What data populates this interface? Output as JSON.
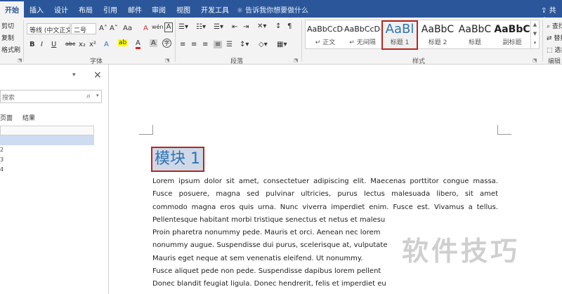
{
  "ribbon_tabs": {
    "home": "开始",
    "insert": "插入",
    "design": "设计",
    "layout": "布局",
    "references": "引用",
    "mailings": "邮件",
    "review": "审阅",
    "view": "视图",
    "developer": "开发工具",
    "tell_me": "告诉我你想要做什么",
    "share": "共享"
  },
  "clipboard": {
    "cut": "剪切",
    "copy": "复制",
    "format_painter": "格式刷"
  },
  "font": {
    "font_name": "等线 (中文正文)",
    "font_size": "二号",
    "group_label": "字体",
    "bold": "B",
    "italic": "I",
    "underline": "U",
    "strike": "abc",
    "subscript": "x₂",
    "superscript": "x²",
    "grow": "A˄",
    "shrink": "A˅",
    "change_case": "Aa",
    "clear": "A",
    "phonetic": "wén",
    "border_char": "A",
    "text_effect": "A",
    "highlight": "ab",
    "font_color": "A",
    "shading": "A",
    "enclosed": "字"
  },
  "paragraph": {
    "group_label": "段落"
  },
  "styles": {
    "group_label": "样式",
    "items": [
      {
        "preview": "AaBbCcDc",
        "name": "↵ 正文"
      },
      {
        "preview": "AaBbCcDc",
        "name": "↵ 无间隔"
      },
      {
        "preview": "AaBl",
        "name": "标题 1"
      },
      {
        "preview": "AaBbC",
        "name": "标题 2"
      },
      {
        "preview": "AaBbC",
        "name": "标题"
      },
      {
        "preview": "AaBbC",
        "name": "副标题"
      }
    ]
  },
  "editing": {
    "find": "查找",
    "replace": "替换",
    "select": "选择",
    "group_label": "编辑"
  },
  "nav_pane": {
    "close": "×",
    "dropdown": "▾",
    "search_placeholder": "搜索",
    "search_icon": "⌕",
    "tab_pages": "页面",
    "tab_results": "结果",
    "rows": [
      "",
      "",
      "2",
      "3",
      "4"
    ]
  },
  "document": {
    "heading": "模块 1",
    "lines": [
      "Lorem ipsum dolor sit amet, consectetuer adipiscing elit. Maecenas porttitor congue massa.",
      "Fusce posuere, magna sed pulvinar ultricies, purus lectus malesuada libero, sit amet",
      "commodo magna eros quis urna. Nunc viverra imperdiet enim. Fusce est. Vivamus a tellus.",
      "Pellentesque habitant morbi tristique senectus et netus et malesu",
      "Proin pharetra nonummy pede. Mauris et orci. Aenean nec lorem",
      "nonummy augue. Suspendisse dui purus, scelerisque at, vulputate",
      "Mauris eget neque at sem venenatis eleifend. Ut nonummy.",
      "Fusce aliquet pede non pede. Suspendisse dapibus lorem pellent",
      "Donec blandit feugiat ligula. Donec hendrerit, felis et imperdiet eu"
    ]
  },
  "watermark": "软件技巧"
}
